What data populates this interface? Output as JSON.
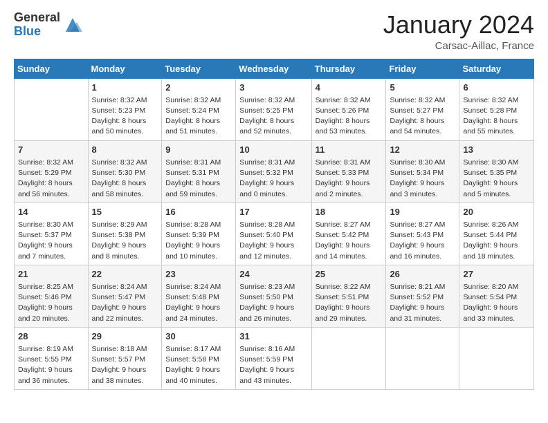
{
  "header": {
    "logo_general": "General",
    "logo_blue": "Blue",
    "month_title": "January 2024",
    "location": "Carsac-Aillac, France"
  },
  "days_of_week": [
    "Sunday",
    "Monday",
    "Tuesday",
    "Wednesday",
    "Thursday",
    "Friday",
    "Saturday"
  ],
  "weeks": [
    [
      {
        "num": "",
        "info": ""
      },
      {
        "num": "1",
        "info": "Sunrise: 8:32 AM\nSunset: 5:23 PM\nDaylight: 8 hours\nand 50 minutes."
      },
      {
        "num": "2",
        "info": "Sunrise: 8:32 AM\nSunset: 5:24 PM\nDaylight: 8 hours\nand 51 minutes."
      },
      {
        "num": "3",
        "info": "Sunrise: 8:32 AM\nSunset: 5:25 PM\nDaylight: 8 hours\nand 52 minutes."
      },
      {
        "num": "4",
        "info": "Sunrise: 8:32 AM\nSunset: 5:26 PM\nDaylight: 8 hours\nand 53 minutes."
      },
      {
        "num": "5",
        "info": "Sunrise: 8:32 AM\nSunset: 5:27 PM\nDaylight: 8 hours\nand 54 minutes."
      },
      {
        "num": "6",
        "info": "Sunrise: 8:32 AM\nSunset: 5:28 PM\nDaylight: 8 hours\nand 55 minutes."
      }
    ],
    [
      {
        "num": "7",
        "info": "Sunrise: 8:32 AM\nSunset: 5:29 PM\nDaylight: 8 hours\nand 56 minutes."
      },
      {
        "num": "8",
        "info": "Sunrise: 8:32 AM\nSunset: 5:30 PM\nDaylight: 8 hours\nand 58 minutes."
      },
      {
        "num": "9",
        "info": "Sunrise: 8:31 AM\nSunset: 5:31 PM\nDaylight: 8 hours\nand 59 minutes."
      },
      {
        "num": "10",
        "info": "Sunrise: 8:31 AM\nSunset: 5:32 PM\nDaylight: 9 hours\nand 0 minutes."
      },
      {
        "num": "11",
        "info": "Sunrise: 8:31 AM\nSunset: 5:33 PM\nDaylight: 9 hours\nand 2 minutes."
      },
      {
        "num": "12",
        "info": "Sunrise: 8:30 AM\nSunset: 5:34 PM\nDaylight: 9 hours\nand 3 minutes."
      },
      {
        "num": "13",
        "info": "Sunrise: 8:30 AM\nSunset: 5:35 PM\nDaylight: 9 hours\nand 5 minutes."
      }
    ],
    [
      {
        "num": "14",
        "info": "Sunrise: 8:30 AM\nSunset: 5:37 PM\nDaylight: 9 hours\nand 7 minutes."
      },
      {
        "num": "15",
        "info": "Sunrise: 8:29 AM\nSunset: 5:38 PM\nDaylight: 9 hours\nand 8 minutes."
      },
      {
        "num": "16",
        "info": "Sunrise: 8:28 AM\nSunset: 5:39 PM\nDaylight: 9 hours\nand 10 minutes."
      },
      {
        "num": "17",
        "info": "Sunrise: 8:28 AM\nSunset: 5:40 PM\nDaylight: 9 hours\nand 12 minutes."
      },
      {
        "num": "18",
        "info": "Sunrise: 8:27 AM\nSunset: 5:42 PM\nDaylight: 9 hours\nand 14 minutes."
      },
      {
        "num": "19",
        "info": "Sunrise: 8:27 AM\nSunset: 5:43 PM\nDaylight: 9 hours\nand 16 minutes."
      },
      {
        "num": "20",
        "info": "Sunrise: 8:26 AM\nSunset: 5:44 PM\nDaylight: 9 hours\nand 18 minutes."
      }
    ],
    [
      {
        "num": "21",
        "info": "Sunrise: 8:25 AM\nSunset: 5:46 PM\nDaylight: 9 hours\nand 20 minutes."
      },
      {
        "num": "22",
        "info": "Sunrise: 8:24 AM\nSunset: 5:47 PM\nDaylight: 9 hours\nand 22 minutes."
      },
      {
        "num": "23",
        "info": "Sunrise: 8:24 AM\nSunset: 5:48 PM\nDaylight: 9 hours\nand 24 minutes."
      },
      {
        "num": "24",
        "info": "Sunrise: 8:23 AM\nSunset: 5:50 PM\nDaylight: 9 hours\nand 26 minutes."
      },
      {
        "num": "25",
        "info": "Sunrise: 8:22 AM\nSunset: 5:51 PM\nDaylight: 9 hours\nand 29 minutes."
      },
      {
        "num": "26",
        "info": "Sunrise: 8:21 AM\nSunset: 5:52 PM\nDaylight: 9 hours\nand 31 minutes."
      },
      {
        "num": "27",
        "info": "Sunrise: 8:20 AM\nSunset: 5:54 PM\nDaylight: 9 hours\nand 33 minutes."
      }
    ],
    [
      {
        "num": "28",
        "info": "Sunrise: 8:19 AM\nSunset: 5:55 PM\nDaylight: 9 hours\nand 36 minutes."
      },
      {
        "num": "29",
        "info": "Sunrise: 8:18 AM\nSunset: 5:57 PM\nDaylight: 9 hours\nand 38 minutes."
      },
      {
        "num": "30",
        "info": "Sunrise: 8:17 AM\nSunset: 5:58 PM\nDaylight: 9 hours\nand 40 minutes."
      },
      {
        "num": "31",
        "info": "Sunrise: 8:16 AM\nSunset: 5:59 PM\nDaylight: 9 hours\nand 43 minutes."
      },
      {
        "num": "",
        "info": ""
      },
      {
        "num": "",
        "info": ""
      },
      {
        "num": "",
        "info": ""
      }
    ]
  ]
}
